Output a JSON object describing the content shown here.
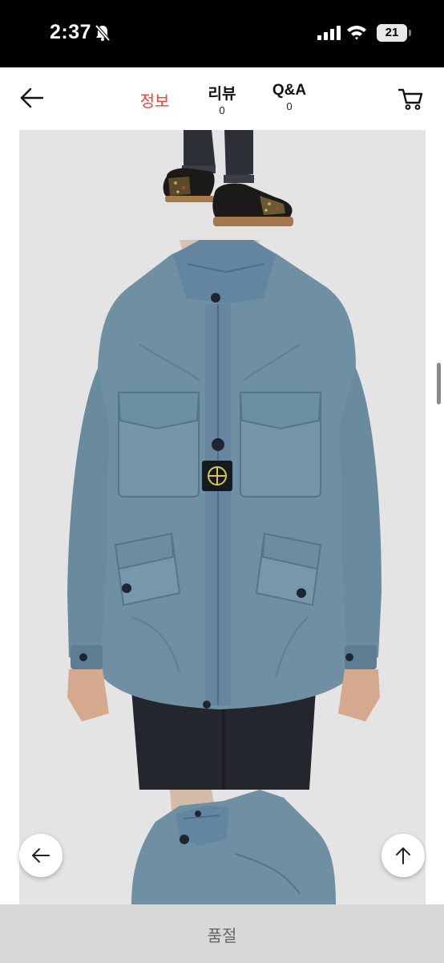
{
  "status_bar": {
    "time": "2:37",
    "battery": "21",
    "icons": [
      "silent-bell-icon",
      "cellular-signal-icon",
      "wifi-icon",
      "battery-icon"
    ]
  },
  "header": {
    "back_icon": "arrow-left-icon",
    "tabs": [
      {
        "label": "정보",
        "count": "",
        "active": true
      },
      {
        "label": "리뷰",
        "count": "0",
        "active": false
      },
      {
        "label": "Q&A",
        "count": "0",
        "active": false
      }
    ],
    "cart_icon": "shopping-cart-icon",
    "active_color": "#e8443a"
  },
  "gallery": {
    "images": [
      {
        "depicts": "shoes-and-jeans-cropped"
      },
      {
        "depicts": "blue-field-jacket-front"
      },
      {
        "depicts": "blue-field-jacket-side"
      }
    ],
    "jacket_color": "#6f8fa3"
  },
  "floating_buttons": {
    "back_icon": "arrow-left-icon",
    "top_icon": "arrow-up-icon"
  },
  "bottom_bar": {
    "label": "품절"
  }
}
